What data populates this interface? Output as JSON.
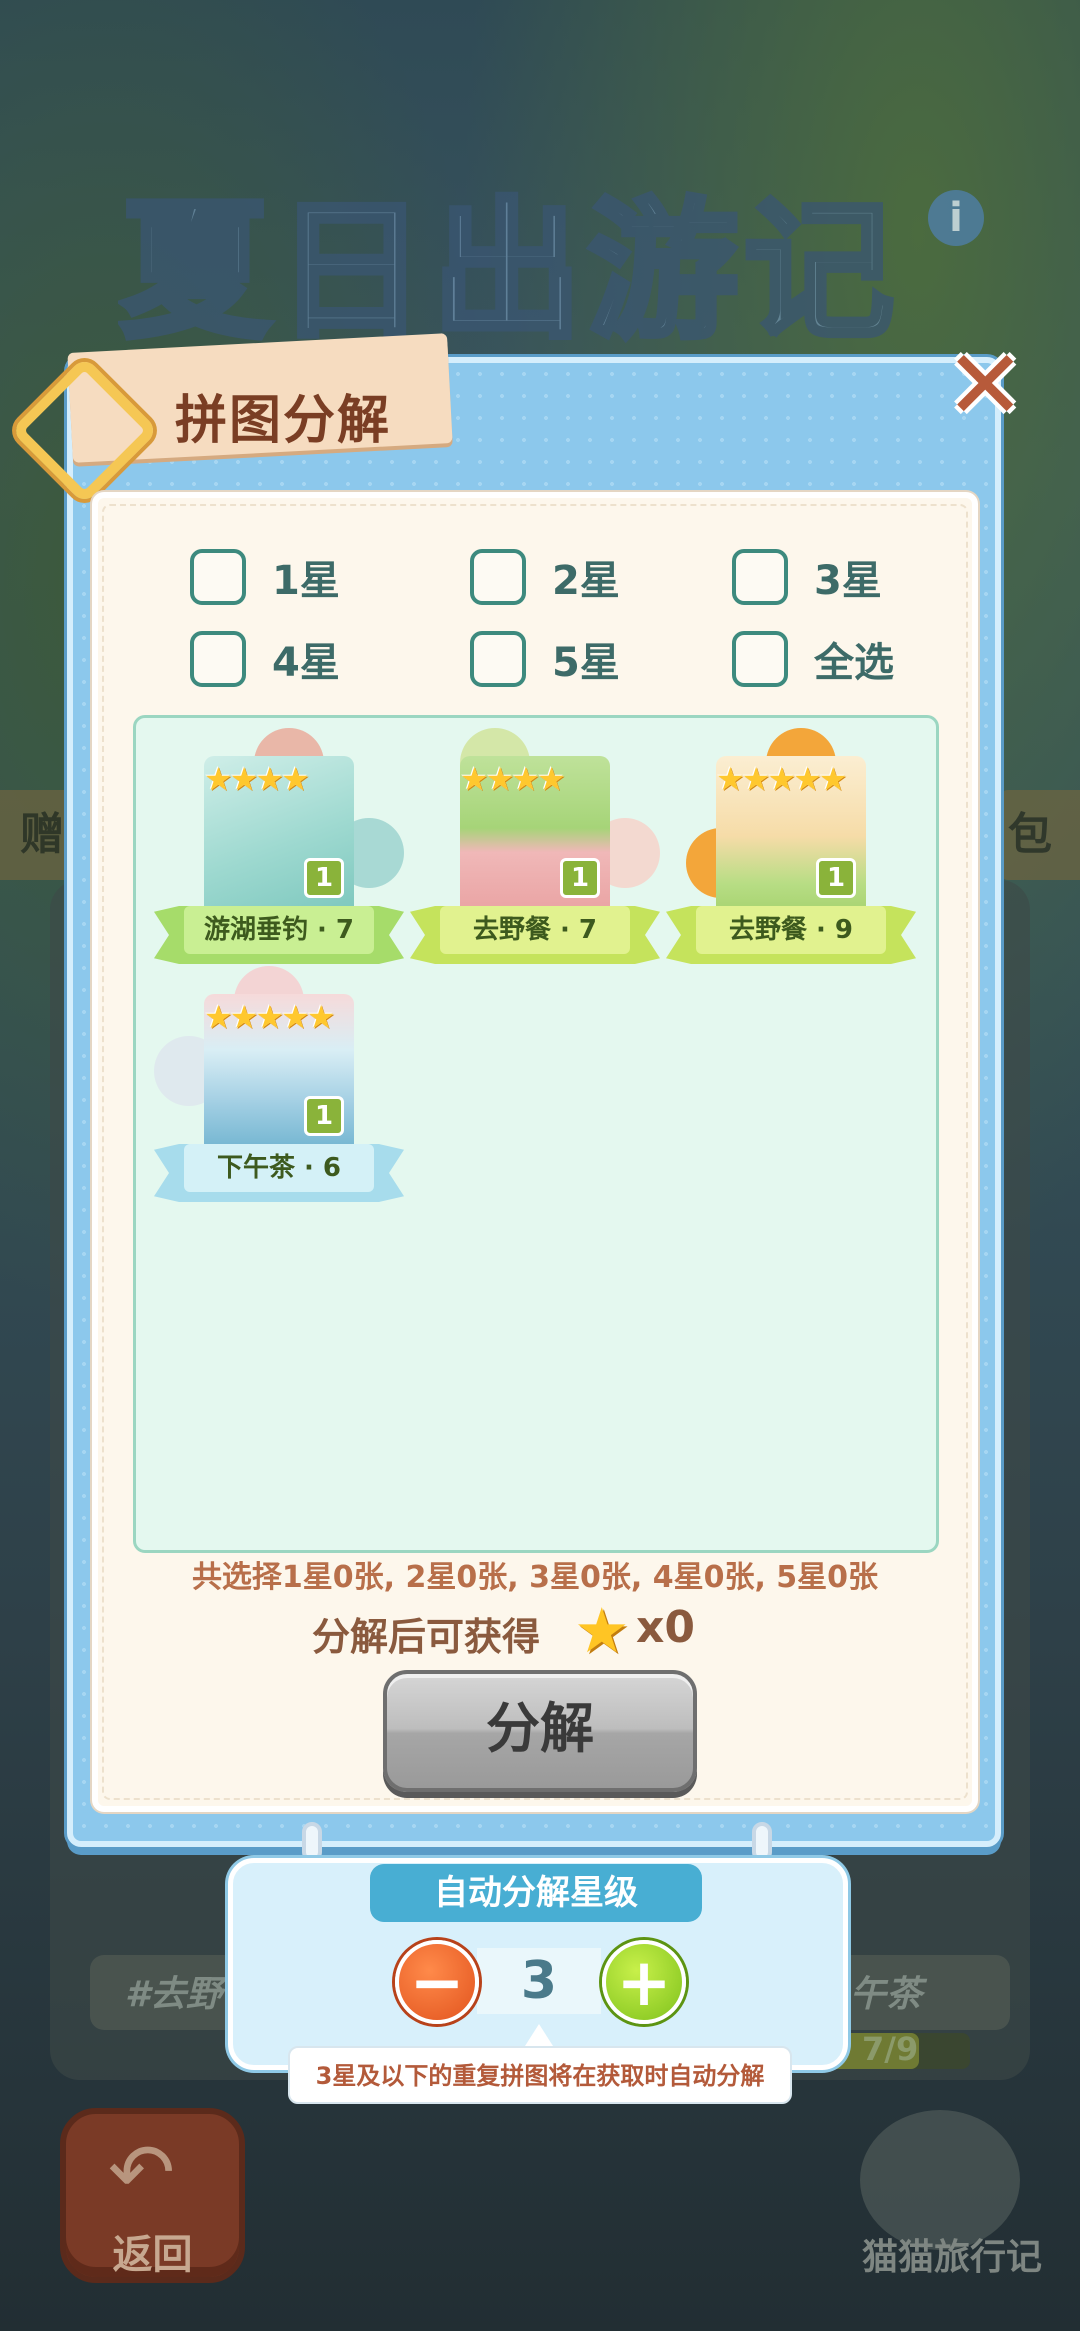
{
  "background": {
    "event_title": "夏日出游记",
    "info_icon": "i",
    "left_tab": "赠",
    "right_tab": "包",
    "strip_left": "#去野",
    "strip_right": "午茶",
    "progress_text": "7/9",
    "back_label": "返回",
    "brand": "猫猫旅行记"
  },
  "dialog": {
    "title": "拼图分解",
    "close_icon": "✕",
    "checkboxes": [
      "1星",
      "2星",
      "3星",
      "4星",
      "5星",
      "全选"
    ],
    "cards": [
      {
        "stars": "★★★★",
        "label": "游湖垂钓 · 7",
        "count": "1",
        "theme": "blue"
      },
      {
        "stars": "★★★★",
        "label": "去野餐 · 7",
        "count": "1",
        "theme": "green"
      },
      {
        "stars": "★★★★★",
        "label": "去野餐 · 9",
        "count": "1",
        "theme": "yellow"
      },
      {
        "stars": "★★★★★",
        "label": "下午茶 · 6",
        "count": "1",
        "theme": "sky"
      }
    ],
    "summary": "共选择1星0张, 2星0张, 3星0张, 4星0张, 5星0张",
    "reward_label": "分解后可获得",
    "reward_count": "x0",
    "decompose_button": "分解"
  },
  "auto_panel": {
    "title": "自动分解星级",
    "minus": "−",
    "value": "3",
    "plus": "+",
    "tip": "3星及以下的重复拼图将在获取时自动分解"
  },
  "colors": {
    "dialog_blue": "#8cc8ec",
    "checkbox_teal": "#3d8a7e",
    "grid_bg": "#e4f8ef",
    "star_gold": "#ffc82e",
    "tip_text": "#b35a3a"
  }
}
